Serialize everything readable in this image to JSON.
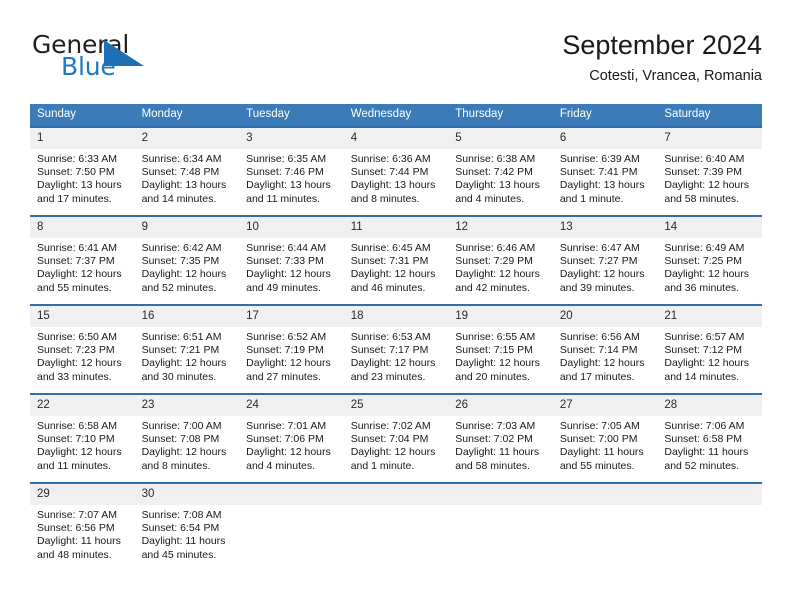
{
  "brand": {
    "name_part1": "General",
    "name_part2": "Blue",
    "logo_icon": "triangle-logo-icon",
    "accent_color": "#1f7ac4"
  },
  "header": {
    "title": "September 2024",
    "subtitle": "Cotesti, Vrancea, Romania"
  },
  "calendar": {
    "header_bg": "#3b7cb8",
    "row_divider_color": "#2f6fad",
    "daynum_bg": "#f0f0f0",
    "weekdays": [
      "Sunday",
      "Monday",
      "Tuesday",
      "Wednesday",
      "Thursday",
      "Friday",
      "Saturday"
    ],
    "weeks": [
      [
        {
          "day": "1",
          "sunrise": "Sunrise: 6:33 AM",
          "sunset": "Sunset: 7:50 PM",
          "daylight1": "Daylight: 13 hours",
          "daylight2": "and 17 minutes."
        },
        {
          "day": "2",
          "sunrise": "Sunrise: 6:34 AM",
          "sunset": "Sunset: 7:48 PM",
          "daylight1": "Daylight: 13 hours",
          "daylight2": "and 14 minutes."
        },
        {
          "day": "3",
          "sunrise": "Sunrise: 6:35 AM",
          "sunset": "Sunset: 7:46 PM",
          "daylight1": "Daylight: 13 hours",
          "daylight2": "and 11 minutes."
        },
        {
          "day": "4",
          "sunrise": "Sunrise: 6:36 AM",
          "sunset": "Sunset: 7:44 PM",
          "daylight1": "Daylight: 13 hours",
          "daylight2": "and 8 minutes."
        },
        {
          "day": "5",
          "sunrise": "Sunrise: 6:38 AM",
          "sunset": "Sunset: 7:42 PM",
          "daylight1": "Daylight: 13 hours",
          "daylight2": "and 4 minutes."
        },
        {
          "day": "6",
          "sunrise": "Sunrise: 6:39 AM",
          "sunset": "Sunset: 7:41 PM",
          "daylight1": "Daylight: 13 hours",
          "daylight2": "and 1 minute."
        },
        {
          "day": "7",
          "sunrise": "Sunrise: 6:40 AM",
          "sunset": "Sunset: 7:39 PM",
          "daylight1": "Daylight: 12 hours",
          "daylight2": "and 58 minutes."
        }
      ],
      [
        {
          "day": "8",
          "sunrise": "Sunrise: 6:41 AM",
          "sunset": "Sunset: 7:37 PM",
          "daylight1": "Daylight: 12 hours",
          "daylight2": "and 55 minutes."
        },
        {
          "day": "9",
          "sunrise": "Sunrise: 6:42 AM",
          "sunset": "Sunset: 7:35 PM",
          "daylight1": "Daylight: 12 hours",
          "daylight2": "and 52 minutes."
        },
        {
          "day": "10",
          "sunrise": "Sunrise: 6:44 AM",
          "sunset": "Sunset: 7:33 PM",
          "daylight1": "Daylight: 12 hours",
          "daylight2": "and 49 minutes."
        },
        {
          "day": "11",
          "sunrise": "Sunrise: 6:45 AM",
          "sunset": "Sunset: 7:31 PM",
          "daylight1": "Daylight: 12 hours",
          "daylight2": "and 46 minutes."
        },
        {
          "day": "12",
          "sunrise": "Sunrise: 6:46 AM",
          "sunset": "Sunset: 7:29 PM",
          "daylight1": "Daylight: 12 hours",
          "daylight2": "and 42 minutes."
        },
        {
          "day": "13",
          "sunrise": "Sunrise: 6:47 AM",
          "sunset": "Sunset: 7:27 PM",
          "daylight1": "Daylight: 12 hours",
          "daylight2": "and 39 minutes."
        },
        {
          "day": "14",
          "sunrise": "Sunrise: 6:49 AM",
          "sunset": "Sunset: 7:25 PM",
          "daylight1": "Daylight: 12 hours",
          "daylight2": "and 36 minutes."
        }
      ],
      [
        {
          "day": "15",
          "sunrise": "Sunrise: 6:50 AM",
          "sunset": "Sunset: 7:23 PM",
          "daylight1": "Daylight: 12 hours",
          "daylight2": "and 33 minutes."
        },
        {
          "day": "16",
          "sunrise": "Sunrise: 6:51 AM",
          "sunset": "Sunset: 7:21 PM",
          "daylight1": "Daylight: 12 hours",
          "daylight2": "and 30 minutes."
        },
        {
          "day": "17",
          "sunrise": "Sunrise: 6:52 AM",
          "sunset": "Sunset: 7:19 PM",
          "daylight1": "Daylight: 12 hours",
          "daylight2": "and 27 minutes."
        },
        {
          "day": "18",
          "sunrise": "Sunrise: 6:53 AM",
          "sunset": "Sunset: 7:17 PM",
          "daylight1": "Daylight: 12 hours",
          "daylight2": "and 23 minutes."
        },
        {
          "day": "19",
          "sunrise": "Sunrise: 6:55 AM",
          "sunset": "Sunset: 7:15 PM",
          "daylight1": "Daylight: 12 hours",
          "daylight2": "and 20 minutes."
        },
        {
          "day": "20",
          "sunrise": "Sunrise: 6:56 AM",
          "sunset": "Sunset: 7:14 PM",
          "daylight1": "Daylight: 12 hours",
          "daylight2": "and 17 minutes."
        },
        {
          "day": "21",
          "sunrise": "Sunrise: 6:57 AM",
          "sunset": "Sunset: 7:12 PM",
          "daylight1": "Daylight: 12 hours",
          "daylight2": "and 14 minutes."
        }
      ],
      [
        {
          "day": "22",
          "sunrise": "Sunrise: 6:58 AM",
          "sunset": "Sunset: 7:10 PM",
          "daylight1": "Daylight: 12 hours",
          "daylight2": "and 11 minutes."
        },
        {
          "day": "23",
          "sunrise": "Sunrise: 7:00 AM",
          "sunset": "Sunset: 7:08 PM",
          "daylight1": "Daylight: 12 hours",
          "daylight2": "and 8 minutes."
        },
        {
          "day": "24",
          "sunrise": "Sunrise: 7:01 AM",
          "sunset": "Sunset: 7:06 PM",
          "daylight1": "Daylight: 12 hours",
          "daylight2": "and 4 minutes."
        },
        {
          "day": "25",
          "sunrise": "Sunrise: 7:02 AM",
          "sunset": "Sunset: 7:04 PM",
          "daylight1": "Daylight: 12 hours",
          "daylight2": "and 1 minute."
        },
        {
          "day": "26",
          "sunrise": "Sunrise: 7:03 AM",
          "sunset": "Sunset: 7:02 PM",
          "daylight1": "Daylight: 11 hours",
          "daylight2": "and 58 minutes."
        },
        {
          "day": "27",
          "sunrise": "Sunrise: 7:05 AM",
          "sunset": "Sunset: 7:00 PM",
          "daylight1": "Daylight: 11 hours",
          "daylight2": "and 55 minutes."
        },
        {
          "day": "28",
          "sunrise": "Sunrise: 7:06 AM",
          "sunset": "Sunset: 6:58 PM",
          "daylight1": "Daylight: 11 hours",
          "daylight2": "and 52 minutes."
        }
      ],
      [
        {
          "day": "29",
          "sunrise": "Sunrise: 7:07 AM",
          "sunset": "Sunset: 6:56 PM",
          "daylight1": "Daylight: 11 hours",
          "daylight2": "and 48 minutes."
        },
        {
          "day": "30",
          "sunrise": "Sunrise: 7:08 AM",
          "sunset": "Sunset: 6:54 PM",
          "daylight1": "Daylight: 11 hours",
          "daylight2": "and 45 minutes."
        },
        {
          "day": "",
          "sunrise": "",
          "sunset": "",
          "daylight1": "",
          "daylight2": "",
          "blank": true
        },
        {
          "day": "",
          "sunrise": "",
          "sunset": "",
          "daylight1": "",
          "daylight2": "",
          "blank": true
        },
        {
          "day": "",
          "sunrise": "",
          "sunset": "",
          "daylight1": "",
          "daylight2": "",
          "blank": true
        },
        {
          "day": "",
          "sunrise": "",
          "sunset": "",
          "daylight1": "",
          "daylight2": "",
          "blank": true
        },
        {
          "day": "",
          "sunrise": "",
          "sunset": "",
          "daylight1": "",
          "daylight2": "",
          "blank": true
        }
      ]
    ]
  }
}
